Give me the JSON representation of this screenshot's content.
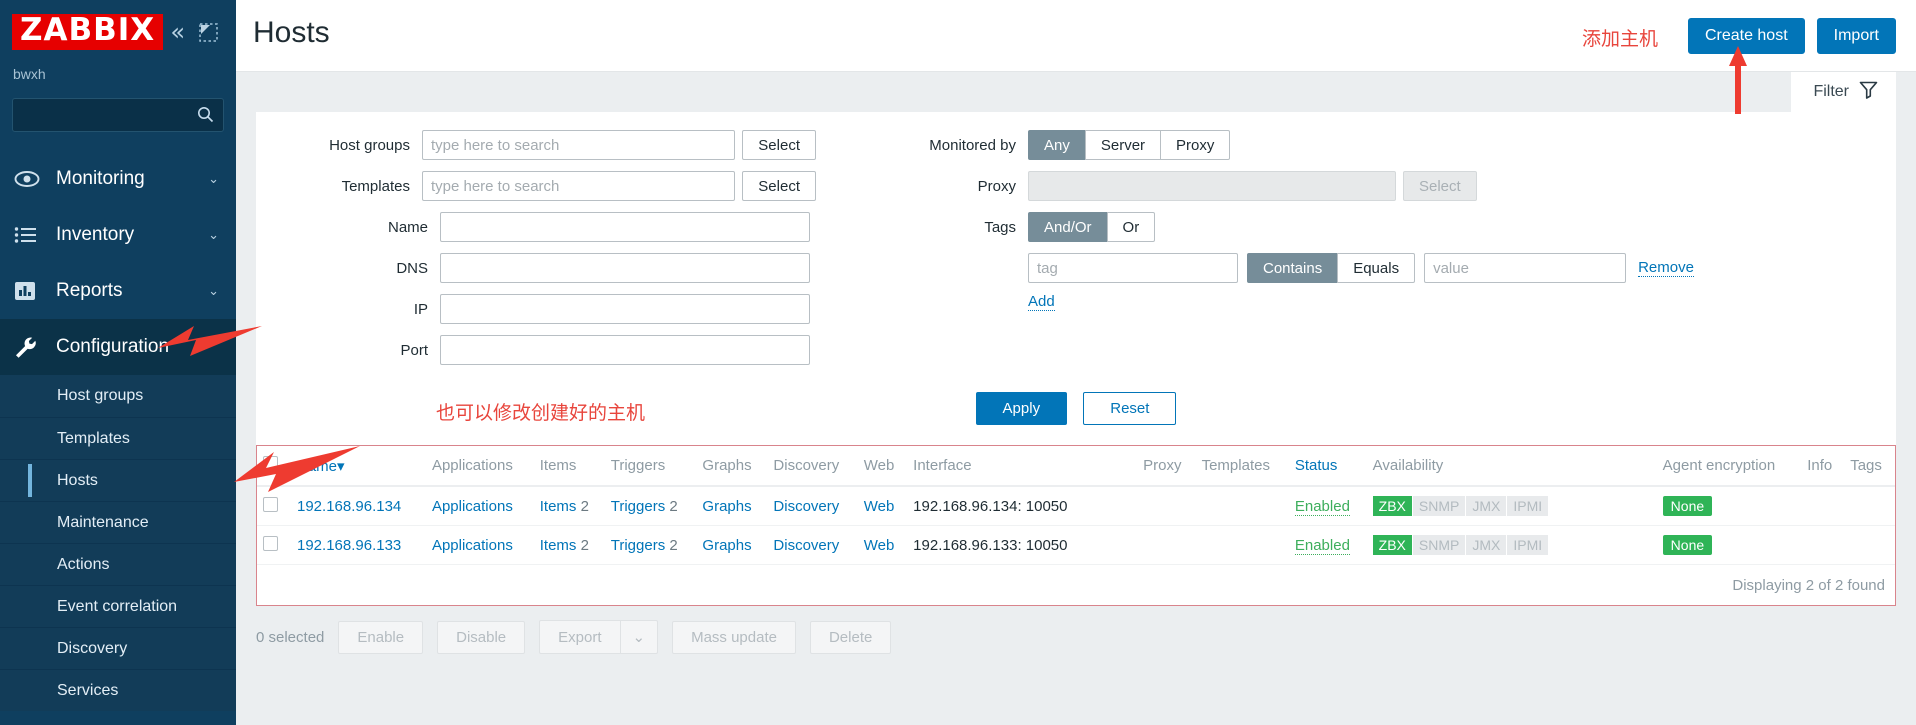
{
  "sidebar": {
    "logo": "ZABBIX",
    "username": "bwxh",
    "collapse_icon": "«",
    "search_value": "",
    "nav": [
      {
        "label": "Monitoring",
        "icon": "eye-icon",
        "caret": "⌄",
        "expanded": false
      },
      {
        "label": "Inventory",
        "icon": "list-icon",
        "caret": "⌄",
        "expanded": false
      },
      {
        "label": "Reports",
        "icon": "chart-icon",
        "caret": "⌄",
        "expanded": false
      },
      {
        "label": "Configuration",
        "icon": "wrench-icon",
        "caret": "⌃",
        "expanded": true
      }
    ],
    "submenu": [
      {
        "label": "Host groups",
        "selected": false
      },
      {
        "label": "Templates",
        "selected": false
      },
      {
        "label": "Hosts",
        "selected": true
      },
      {
        "label": "Maintenance",
        "selected": false
      },
      {
        "label": "Actions",
        "selected": false
      },
      {
        "label": "Event correlation",
        "selected": false
      },
      {
        "label": "Discovery",
        "selected": false
      },
      {
        "label": "Services",
        "selected": false
      }
    ]
  },
  "header": {
    "title": "Hosts",
    "annotation_cn": "添加主机",
    "create_host_label": "Create host",
    "import_label": "Import"
  },
  "filter": {
    "tab_label": "Filter",
    "host_groups_label": "Host groups",
    "host_groups_value": "",
    "host_groups_placeholder": "type here to search",
    "host_groups_select": "Select",
    "templates_label": "Templates",
    "templates_value": "",
    "templates_placeholder": "type here to search",
    "templates_select": "Select",
    "name_label": "Name",
    "name_value": "",
    "dns_label": "DNS",
    "dns_value": "",
    "ip_label": "IP",
    "ip_value": "",
    "port_label": "Port",
    "port_value": "",
    "monitored_by_label": "Monitored by",
    "monitored_by_options": [
      "Any",
      "Server",
      "Proxy"
    ],
    "monitored_by_selected": "Any",
    "proxy_label": "Proxy",
    "proxy_value": "",
    "proxy_select": "Select",
    "tags_label": "Tags",
    "tags_mode_options": [
      "And/Or",
      "Or"
    ],
    "tags_mode_selected": "And/Or",
    "tag_placeholder": "tag",
    "tag_value": "",
    "operator_options": [
      "Contains",
      "Equals"
    ],
    "operator_selected": "Contains",
    "value_placeholder": "value",
    "value_value": "",
    "remove_label": "Remove",
    "add_label": "Add",
    "apply_label": "Apply",
    "reset_label": "Reset",
    "annotation_cn": "也可以修改创建好的主机"
  },
  "table": {
    "columns": [
      "Name",
      "Applications",
      "Items",
      "Triggers",
      "Graphs",
      "Discovery",
      "Web",
      "Interface",
      "Proxy",
      "Templates",
      "Status",
      "Availability",
      "Agent encryption",
      "Info",
      "Tags"
    ],
    "sort_column": "Name",
    "sort_indicator": "▾",
    "availability_labels": [
      "ZBX",
      "SNMP",
      "JMX",
      "IPMI"
    ],
    "rows": [
      {
        "name": "192.168.96.134",
        "applications": "Applications",
        "items": "Items",
        "items_count": "2",
        "triggers": "Triggers",
        "triggers_count": "2",
        "graphs": "Graphs",
        "discovery": "Discovery",
        "web": "Web",
        "interface": "192.168.96.134: 10050",
        "proxy": "",
        "templates": "",
        "status": "Enabled",
        "availability": {
          "ZBX": "ok",
          "SNMP": "off",
          "JMX": "off",
          "IPMI": "off"
        },
        "agent_encryption": "None",
        "info": "",
        "tags": ""
      },
      {
        "name": "192.168.96.133",
        "applications": "Applications",
        "items": "Items",
        "items_count": "2",
        "triggers": "Triggers",
        "triggers_count": "2",
        "graphs": "Graphs",
        "discovery": "Discovery",
        "web": "Web",
        "interface": "192.168.96.133: 10050",
        "proxy": "",
        "templates": "",
        "status": "Enabled",
        "availability": {
          "ZBX": "ok",
          "SNMP": "off",
          "JMX": "off",
          "IPMI": "off"
        },
        "agent_encryption": "None",
        "info": "",
        "tags": ""
      }
    ],
    "footer": "Displaying 2 of 2 found"
  },
  "bottom_bar": {
    "selected_text": "0 selected",
    "enable_label": "Enable",
    "disable_label": "Disable",
    "export_label": "Export",
    "export_caret": "⌄",
    "mass_update_label": "Mass update",
    "delete_label": "Delete"
  },
  "colors": {
    "brand_red": "#e60000",
    "sidebar_bg": "#0f3f5f",
    "accent_blue": "#0275b8",
    "status_green": "#2fb457",
    "annotation_red": "#e8453c"
  }
}
